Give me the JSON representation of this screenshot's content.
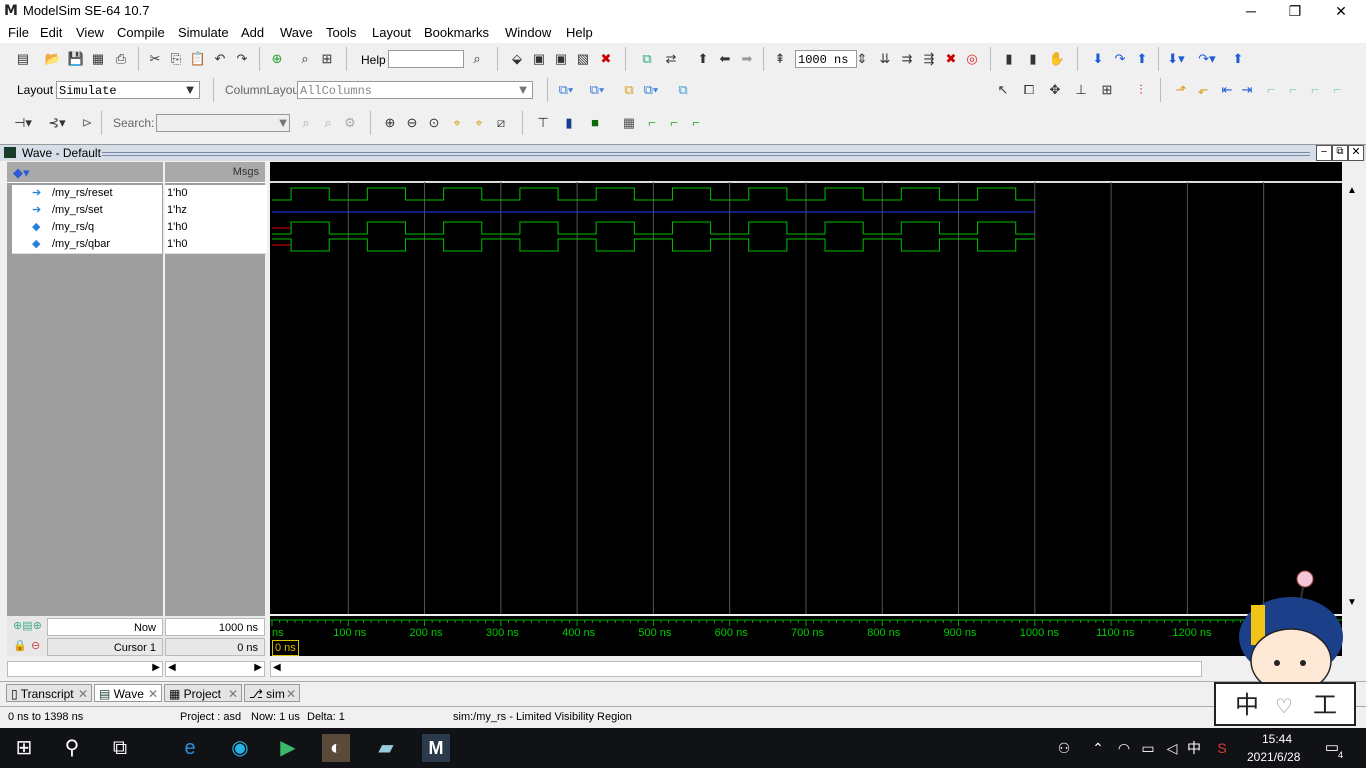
{
  "window": {
    "title": "ModelSim SE-64 10.7",
    "logo": "M",
    "min": "─",
    "max": "❐",
    "close": "✕"
  },
  "menu": [
    "File",
    "Edit",
    "View",
    "Compile",
    "Simulate",
    "Add",
    "Wave",
    "Tools",
    "Layout",
    "Bookmarks",
    "Window",
    "Help"
  ],
  "toolbar": {
    "help_label": "Help",
    "run_length": "1000 ns"
  },
  "layout_bar": {
    "layout_label": "Layout",
    "layout_value": "Simulate",
    "column_label": "ColumnLayout",
    "column_value": "AllColumns"
  },
  "search_bar": {
    "search_label": "Search:"
  },
  "wave": {
    "title": "Wave - Default",
    "msgs_header": "Msgs",
    "signals": [
      {
        "name": "/my_rs/reset",
        "value": "1'h0"
      },
      {
        "name": "/my_rs/set",
        "value": "1'hz"
      },
      {
        "name": "/my_rs/q",
        "value": "1'h0"
      },
      {
        "name": "/my_rs/qbar",
        "value": "1'h0"
      }
    ],
    "now_label": "Now",
    "now_value": "1000 ns",
    "cursor_label": "Cursor 1",
    "cursor_value": "0 ns",
    "cursor_marker": "0 ns",
    "time_labels": [
      "ns",
      "100 ns",
      "200 ns",
      "300 ns",
      "400 ns",
      "500 ns",
      "600 ns",
      "700 ns",
      "800 ns",
      "900 ns",
      "1000 ns",
      "1100 ns",
      "1200 ns"
    ],
    "colors": {
      "trace": "#00c000",
      "z": "#1a3cff",
      "x": "#e00000",
      "grid": "#555555"
    }
  },
  "tabs": [
    {
      "label": "Transcript",
      "active": false
    },
    {
      "label": "Wave",
      "active": true
    },
    {
      "label": "Project",
      "active": false
    },
    {
      "label": "sim",
      "active": false
    }
  ],
  "status": {
    "range": "0 ns to 1398 ns",
    "project": "Project : asd",
    "now": "Now: 1 us",
    "delta": "Delta: 1",
    "region": "sim:/my_rs - Limited Visibility Region"
  },
  "taskbar": {
    "time": "15:44",
    "date": "2021/6/28",
    "ime": "中",
    "notifications": "4"
  }
}
